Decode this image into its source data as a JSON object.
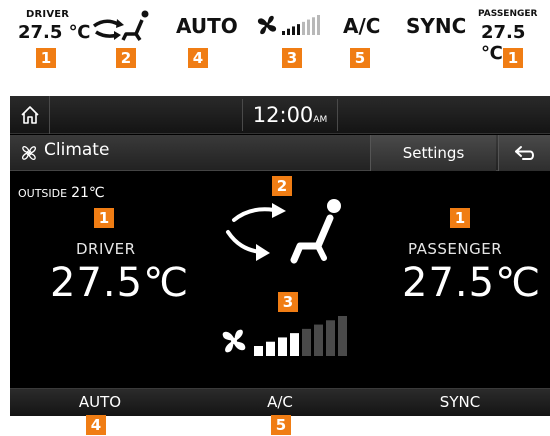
{
  "strip": {
    "driver_label": "DRIVER",
    "driver_temp": "27.5 ℃",
    "auto_label": "AUTO",
    "ac_label": "A/C",
    "sync_label": "SYNC",
    "passenger_label": "PASSENGER",
    "passenger_temp": "27.5 ℃",
    "fan_bars_total": 8,
    "fan_bars_lit": 4
  },
  "callouts": {
    "temp": "1",
    "airflow": "2",
    "fan": "3",
    "auto": "4",
    "ac": "5"
  },
  "statusbar": {
    "time": "12:00",
    "ampm": "AM",
    "home_icon": "home-icon"
  },
  "titlebar": {
    "title": "Climate",
    "title_icon": "fan-icon",
    "settings_label": "Settings",
    "back_icon": "back-arrow-icon"
  },
  "main": {
    "outside_label": "OUTSIDE",
    "outside_temp": "21℃",
    "driver_label": "DRIVER",
    "driver_temp": "27.5℃",
    "passenger_label": "PASSENGER",
    "passenger_temp": "27.5℃",
    "fan_bars_total": 8,
    "fan_bars_lit": 4
  },
  "bottombar": {
    "auto_label": "AUTO",
    "ac_label": "A/C",
    "sync_label": "SYNC"
  },
  "colors": {
    "callout": "#f07d14",
    "screen_bg": "#000000",
    "fan_bar_lit": "#ffffff",
    "fan_bar_dim": "#4a4a4a"
  }
}
